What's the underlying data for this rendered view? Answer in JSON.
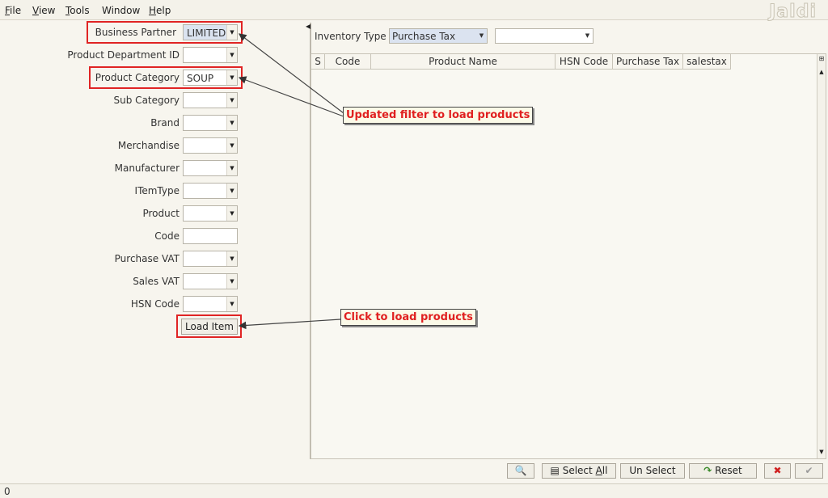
{
  "menu": {
    "items": [
      {
        "underline": "F",
        "rest": "ile"
      },
      {
        "underline": "V",
        "rest": "iew"
      },
      {
        "underline": "T",
        "rest": "ools"
      },
      {
        "underline": "",
        "rest": "Window"
      },
      {
        "underline": "H",
        "rest": "elp"
      }
    ]
  },
  "logo": "Jaldi",
  "filters": {
    "business_partner": {
      "label": "Business Partner",
      "value": "LIMITED"
    },
    "product_department": {
      "label": "Product Department ID",
      "value": ""
    },
    "product_category": {
      "label": "Product Category",
      "value": "SOUP"
    },
    "sub_category": {
      "label": "Sub Category",
      "value": ""
    },
    "brand": {
      "label": "Brand",
      "value": ""
    },
    "merchandise": {
      "label": "Merchandise",
      "value": ""
    },
    "manufacturer": {
      "label": "Manufacturer",
      "value": ""
    },
    "item_type": {
      "label": "ITemType",
      "value": ""
    },
    "product": {
      "label": "Product",
      "value": ""
    },
    "code": {
      "label": "Code",
      "value": ""
    },
    "purchase_vat": {
      "label": "Purchase VAT",
      "value": ""
    },
    "sales_vat": {
      "label": "Sales VAT",
      "value": ""
    },
    "hsn_code": {
      "label": "HSN Code",
      "value": ""
    },
    "load_button": "Load Item"
  },
  "inventory": {
    "label": "Inventory Type",
    "type_value": "Purchase Tax",
    "second_value": ""
  },
  "table": {
    "columns": [
      "S",
      "Code",
      "Product Name",
      "HSN Code",
      "Purchase Tax",
      "salestax"
    ]
  },
  "callouts": {
    "filter": "Updated filter to load products",
    "load": "Click to load products"
  },
  "toolbar": {
    "select_all_pre": "Select ",
    "select_all_ul": "A",
    "select_all_post": "ll",
    "unselect": "Un Select",
    "reset": "Reset"
  },
  "status": {
    "text": "0"
  },
  "colors": {
    "callout_text": "#e02020",
    "highlight_border": "#e02424",
    "selected_combo": "#dbe3f0"
  }
}
